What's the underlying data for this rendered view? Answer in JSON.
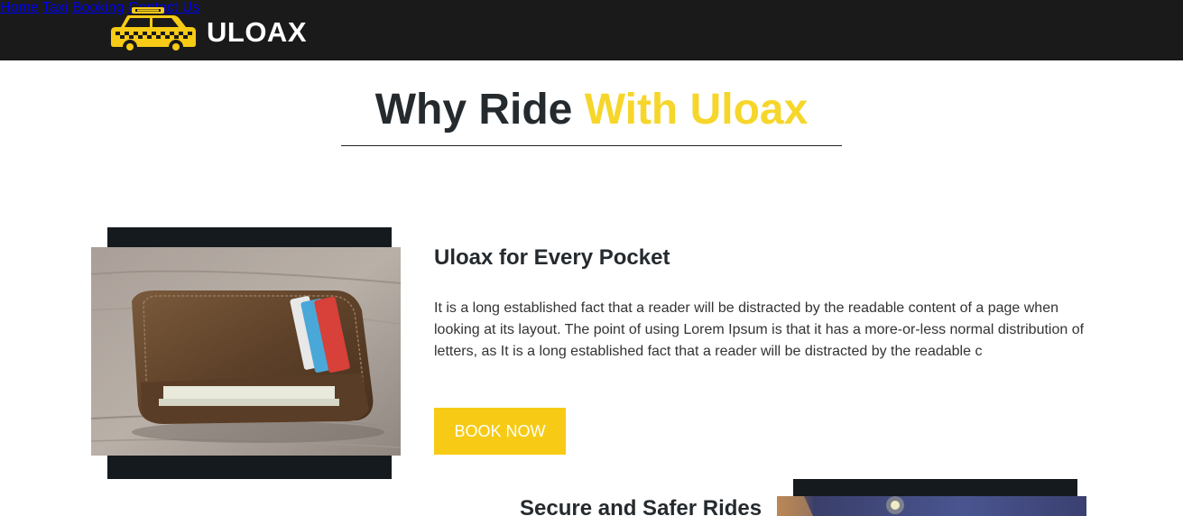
{
  "brand": {
    "name": "ULOAX"
  },
  "nav": {
    "items": [
      {
        "label": "Home"
      },
      {
        "label": "Taxi"
      },
      {
        "label": "Booking"
      },
      {
        "label": "Contact Us"
      }
    ]
  },
  "section": {
    "title_main": "Why Ride",
    "title_accent": "With Uloax"
  },
  "features": [
    {
      "heading": "Uloax for Every Pocket",
      "text": "It is a long established fact that a reader will be distracted by the readable content of a page when looking at its layout. The point of using Lorem Ipsum is that it has a more-or-less normal distribution of letters, as It is a long established fact that a reader will be distracted by the readable c",
      "button_label": "BOOK NOW",
      "image": "wallet-photo"
    },
    {
      "heading": "Secure and Safer Rides",
      "image": "night-street-photo"
    }
  ],
  "colors": {
    "navbar_bg": "#1a1a1a",
    "accent_yellow": "#f6d62a",
    "button_yellow": "#f7cb15",
    "frame_dark": "#151a1e"
  }
}
